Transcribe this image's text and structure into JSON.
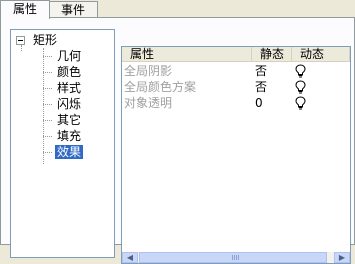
{
  "tabs": [
    {
      "label": "属性",
      "active": true
    },
    {
      "label": "事件",
      "active": false
    }
  ],
  "tree": {
    "root": {
      "label": "矩形",
      "expanded": true
    },
    "children": [
      {
        "label": "几何",
        "selected": false
      },
      {
        "label": "颜色",
        "selected": false
      },
      {
        "label": "样式",
        "selected": false
      },
      {
        "label": "闪烁",
        "selected": false
      },
      {
        "label": "其它",
        "selected": false
      },
      {
        "label": "填充",
        "selected": false
      },
      {
        "label": "效果",
        "selected": true
      }
    ]
  },
  "grid": {
    "columns": [
      "属性",
      "静态",
      "动态"
    ],
    "rows": [
      {
        "name": "全局阴影",
        "static": "否",
        "dynamic_icon": "lightbulb-icon"
      },
      {
        "name": "全局颜色方案",
        "static": "否",
        "dynamic_icon": "lightbulb-icon"
      },
      {
        "name": "对象透明",
        "static": "0",
        "dynamic_icon": "lightbulb-icon"
      }
    ]
  },
  "colors": {
    "selection": "#316ac5",
    "disabled_text": "#a0a0a0",
    "header_bg": "#ebeadb",
    "scroll_blue": "#c8d6f8"
  }
}
